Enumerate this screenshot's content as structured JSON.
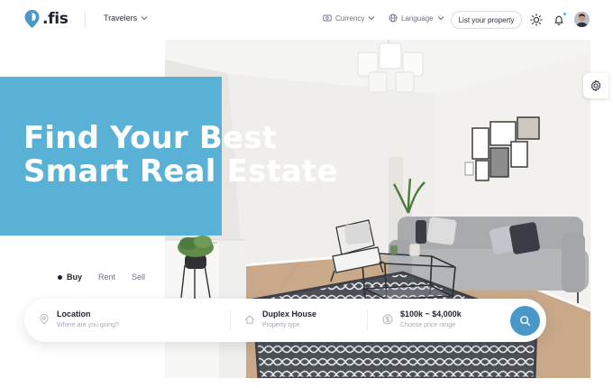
{
  "brand": {
    "name": ".fis",
    "accent": "#5ab1d6",
    "logo_color": "#4a98c9"
  },
  "nav": {
    "travelers": "Travelers",
    "currency": "Currency",
    "language": "Language",
    "list_property": "List your property",
    "icons": [
      "sun-icon",
      "bell-icon"
    ]
  },
  "hero": {
    "headline_line1": "Find Your Best",
    "headline_line2": "Smart Real Estate"
  },
  "tabs": [
    {
      "label": "Buy",
      "active": true
    },
    {
      "label": "Rent",
      "active": false
    },
    {
      "label": "Sell",
      "active": false
    }
  ],
  "search": {
    "location": {
      "title": "Location",
      "subtitle": "Where are you going?"
    },
    "property": {
      "title": "Duplex House",
      "subtitle": "Property type"
    },
    "price": {
      "title": "$100k ~ $4,000k",
      "subtitle": "Choose price range"
    },
    "button_color": "#4a98c9"
  }
}
